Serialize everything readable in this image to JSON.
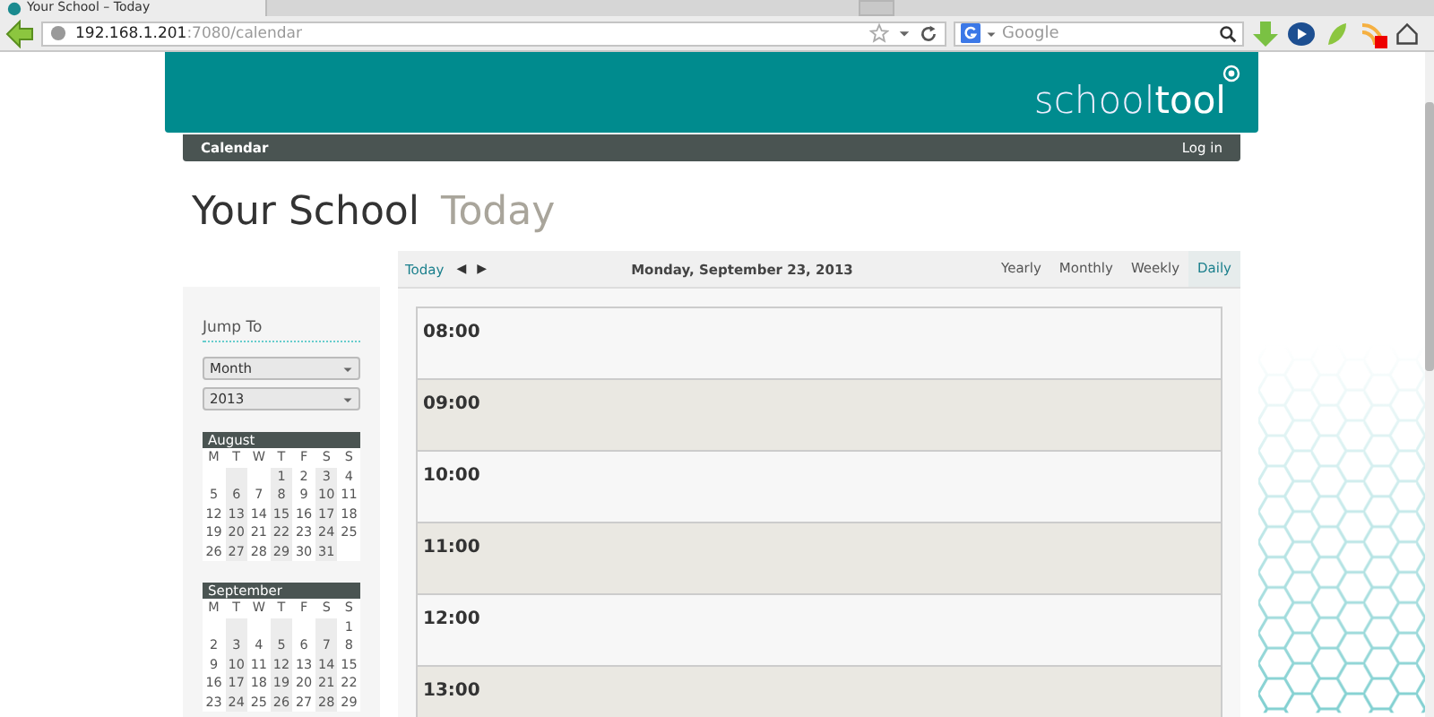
{
  "browser": {
    "tab_title": "Your School – Today",
    "url_host": "192.168.1.201",
    "url_path": ":7080/calendar",
    "search_placeholder": "Google"
  },
  "header": {
    "logo_light": "school",
    "logo_bold": "tool"
  },
  "navbar": {
    "left": "Calendar",
    "right": "Log in"
  },
  "page_title": {
    "main": "Your School",
    "sub": "Today"
  },
  "sidebar": {
    "heading": "Jump To",
    "selects": [
      {
        "value": "Month"
      },
      {
        "value": "2013"
      }
    ],
    "months": [
      {
        "name": "August",
        "weekdays": [
          "M",
          "T",
          "W",
          "T",
          "F",
          "S",
          "S"
        ],
        "weeks": [
          [
            "1",
            "2",
            "3",
            "4"
          ],
          [
            "5",
            "6",
            "7",
            "8",
            "9",
            "10",
            "11"
          ],
          [
            "12",
            "13",
            "14",
            "15",
            "16",
            "17",
            "18"
          ],
          [
            "19",
            "20",
            "21",
            "22",
            "23",
            "24",
            "25"
          ],
          [
            "26",
            "27",
            "28",
            "29",
            "30",
            "31"
          ]
        ]
      },
      {
        "name": "September",
        "weekdays": [
          "M",
          "T",
          "W",
          "T",
          "F",
          "S",
          "S"
        ],
        "weeks": [
          [
            "1"
          ],
          [
            "2",
            "3",
            "4",
            "5",
            "6",
            "7",
            "8"
          ],
          [
            "9",
            "10",
            "11",
            "12",
            "13",
            "14",
            "15"
          ],
          [
            "16",
            "17",
            "18",
            "19",
            "20",
            "21",
            "22"
          ],
          [
            "23",
            "24",
            "25",
            "26",
            "27",
            "28",
            "29"
          ]
        ]
      }
    ]
  },
  "calendar": {
    "today": "Today",
    "prev": "◀",
    "next": "▶",
    "date": "Monday, September 23, 2013",
    "views": [
      {
        "label": "Yearly",
        "selected": false
      },
      {
        "label": "Monthly",
        "selected": false
      },
      {
        "label": "Weekly",
        "selected": false
      },
      {
        "label": "Daily",
        "selected": true
      }
    ],
    "hours": [
      "08:00",
      "09:00",
      "10:00",
      "11:00",
      "12:00",
      "13:00"
    ]
  }
}
